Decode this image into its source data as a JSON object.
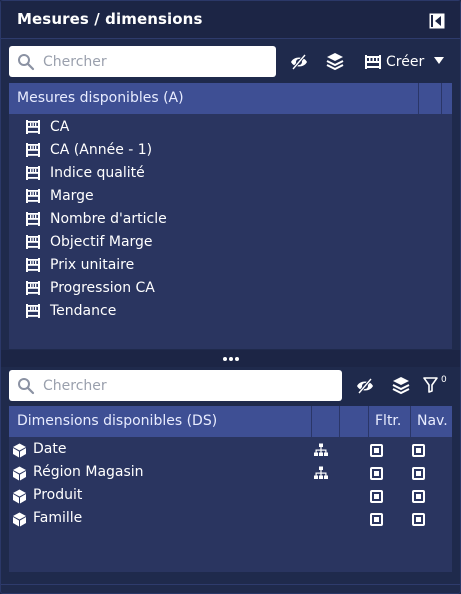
{
  "panel": {
    "title": "Mesures / dimensions"
  },
  "measures": {
    "search_placeholder": "Chercher",
    "create_label": "Créer",
    "header": "Mesures disponibles (A)",
    "items": [
      {
        "label": "CA"
      },
      {
        "label": "CA (Année - 1)"
      },
      {
        "label": "Indice qualité"
      },
      {
        "label": "Marge"
      },
      {
        "label": "Nombre d'article"
      },
      {
        "label": "Objectif Marge"
      },
      {
        "label": "Prix unitaire"
      },
      {
        "label": "Progression CA"
      },
      {
        "label": "Tendance"
      }
    ]
  },
  "dimensions": {
    "search_placeholder": "Chercher",
    "filter_count": "0",
    "header": "Dimensions disponibles (DS)",
    "col_filter": "Fltr.",
    "col_nav": "Nav.",
    "items": [
      {
        "label": "Date",
        "hierarchy": true,
        "filter": true,
        "nav": true
      },
      {
        "label": "Région Magasin",
        "hierarchy": true,
        "filter": true,
        "nav": true
      },
      {
        "label": "Produit",
        "hierarchy": false,
        "filter": true,
        "nav": true
      },
      {
        "label": "Famille",
        "hierarchy": false,
        "filter": true,
        "nav": true
      }
    ]
  },
  "colors": {
    "panel_bg": "#1f2a4c",
    "list_bg": "#2a3560",
    "header_bg": "#3e4f94",
    "text": "#ffffff"
  }
}
